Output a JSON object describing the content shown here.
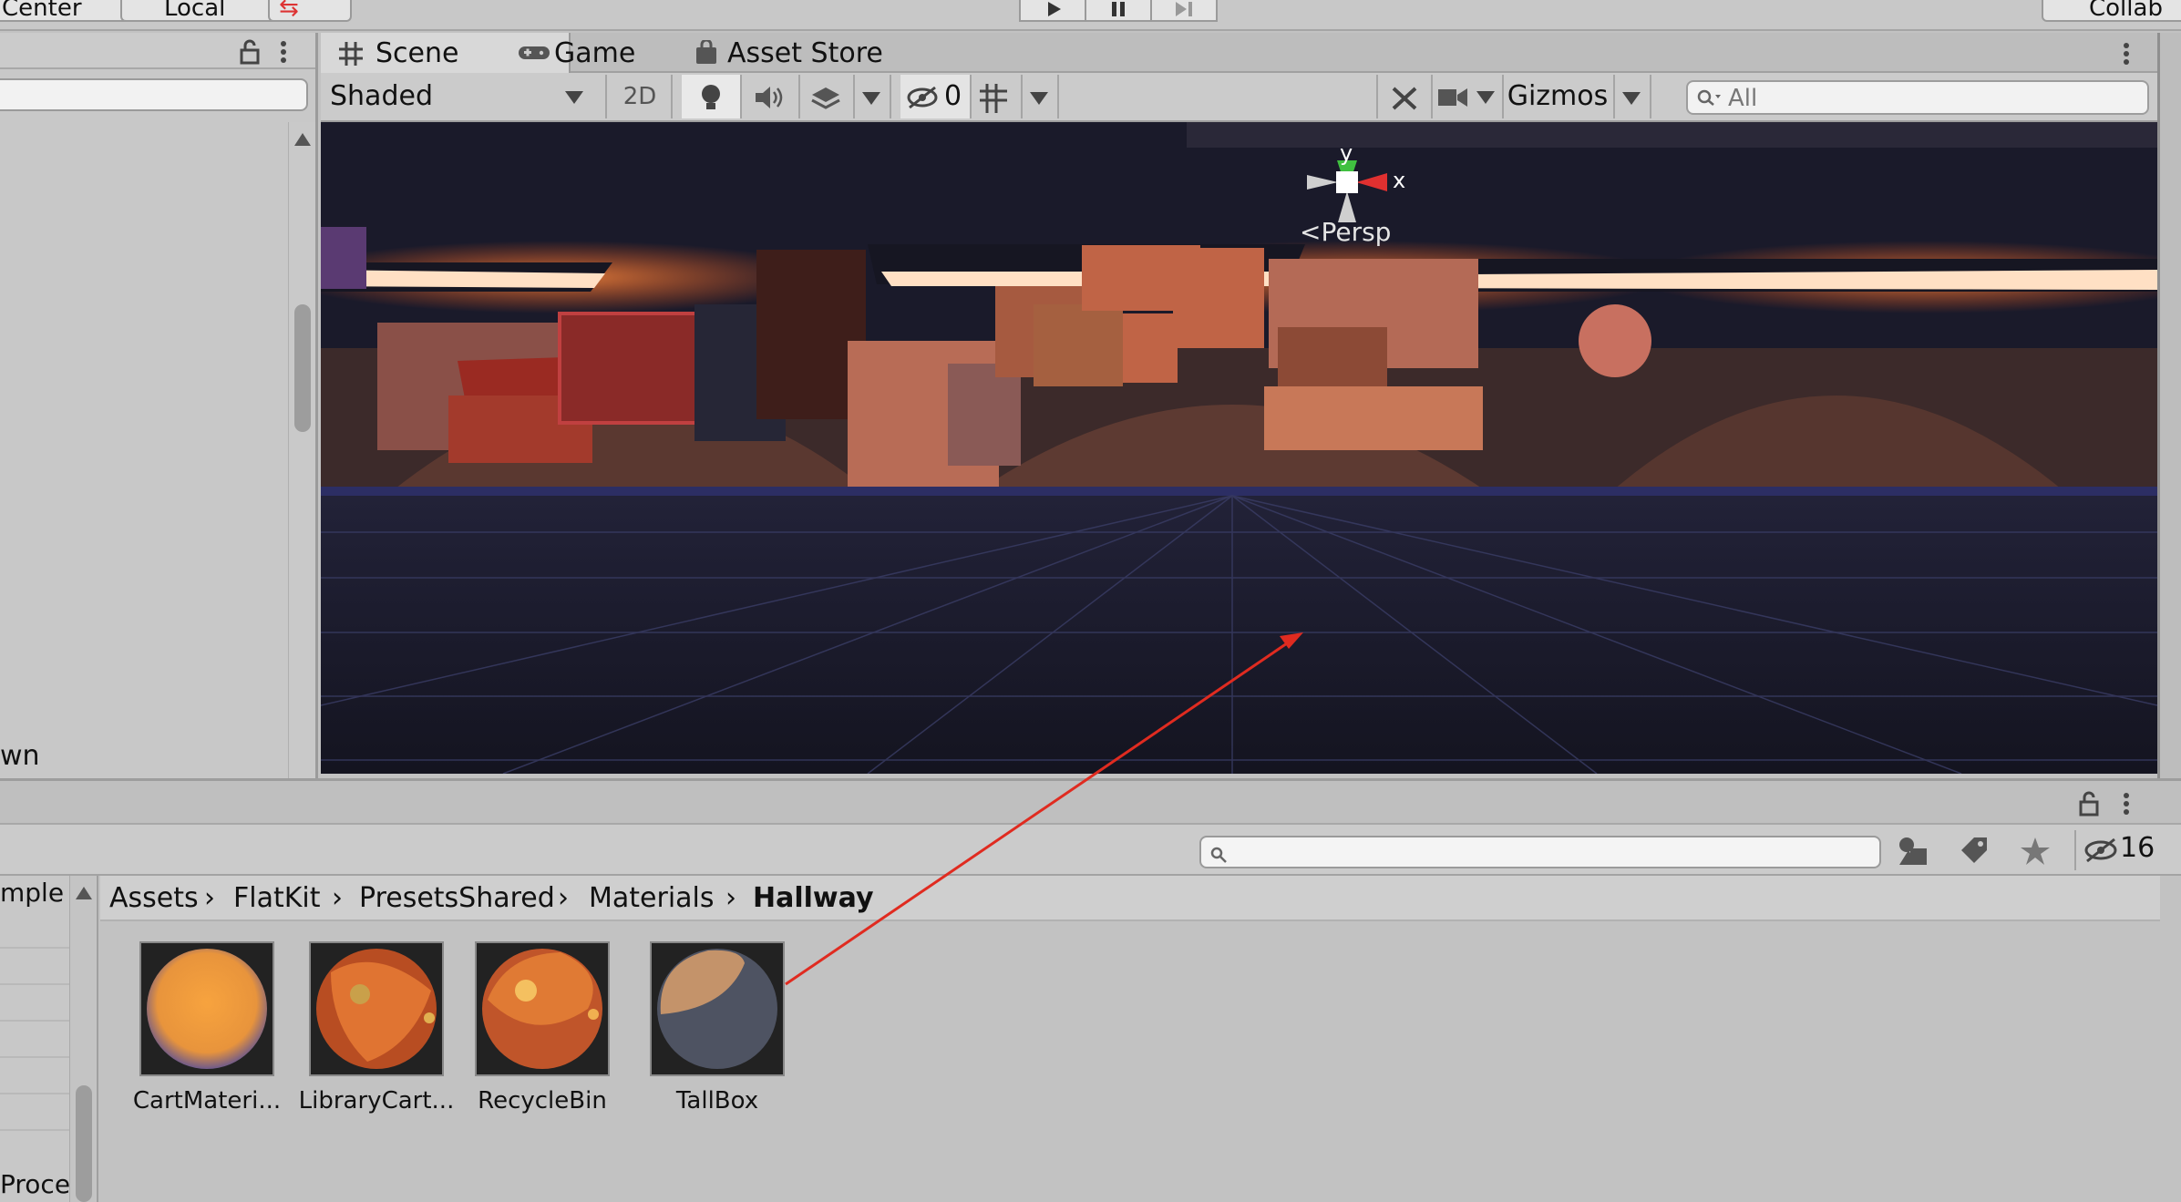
{
  "toolbar": {
    "pivot_label": "Center",
    "space_label": "Local",
    "collab_label": "Collab"
  },
  "scene": {
    "tabs": [
      {
        "label": "Scene",
        "icon": "grid-icon"
      },
      {
        "label": "Game",
        "icon": "gamepad-icon"
      },
      {
        "label": "Asset Store",
        "icon": "shopping-bag-icon"
      }
    ],
    "draw_mode": "Shaded",
    "mode_2d": "2D",
    "hidden_count": "0",
    "gizmos_label": "Gizmos",
    "search_placeholder": "All",
    "gizmo": {
      "y": "y",
      "x": "x",
      "projection": "Persp"
    }
  },
  "hierarchy": {
    "partial_label": "wn"
  },
  "project": {
    "hidden_count": "16",
    "tree_partial_label": "mple",
    "tree_partial_bottom": "Proce",
    "breadcrumbs": [
      "Assets",
      "FlatKit",
      "PresetsShared",
      "Materials",
      "Hallway"
    ],
    "assets": [
      {
        "name": "CartMateri...",
        "colors": [
          "#f6a03c",
          "#d88a3a",
          "#6f5a8a"
        ]
      },
      {
        "name": "LibraryCart...",
        "colors": [
          "#e07432",
          "#b84d22",
          "#d9a04a"
        ]
      },
      {
        "name": "RecycleBin",
        "colors": [
          "#e07a34",
          "#c0552a",
          "#f4c060"
        ]
      },
      {
        "name": "TallBox",
        "colors": [
          "#4e5362",
          "#c4936a",
          "#3b3f4b"
        ]
      }
    ]
  },
  "annotation_color": "#e02b20"
}
